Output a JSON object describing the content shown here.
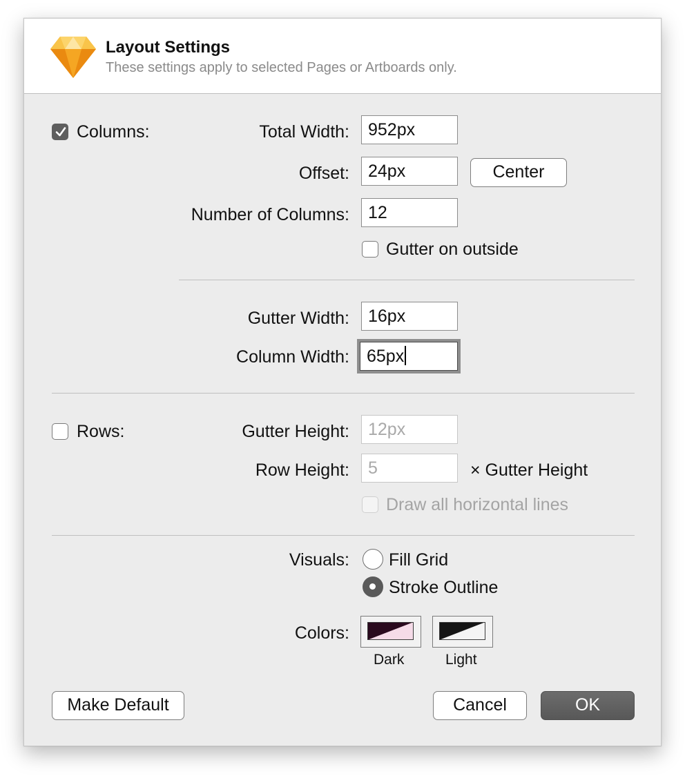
{
  "header": {
    "title": "Layout Settings",
    "subtitle": "These settings apply to selected Pages or Artboards only.",
    "logo_icon": "sketch-diamond-icon"
  },
  "columns": {
    "checkbox_label": "Columns:",
    "checked": true,
    "total_width_label": "Total Width:",
    "total_width_value": "952px",
    "offset_label": "Offset:",
    "offset_value": "24px",
    "center_label": "Center",
    "number_label": "Number of Columns:",
    "number_value": "12",
    "gutter_outside_label": "Gutter on outside",
    "gutter_outside_checked": false,
    "gutter_width_label": "Gutter Width:",
    "gutter_width_value": "16px",
    "column_width_label": "Column Width:",
    "column_width_value": "65px"
  },
  "rows": {
    "checkbox_label": "Rows:",
    "checked": false,
    "gutter_height_label": "Gutter Height:",
    "gutter_height_value": "12px",
    "row_height_label": "Row Height:",
    "row_height_value": "5",
    "row_height_suffix": "× Gutter Height",
    "draw_lines_label": "Draw all horizontal lines"
  },
  "visuals": {
    "label": "Visuals:",
    "options": [
      "Fill Grid",
      "Stroke Outline"
    ],
    "selected": "Stroke Outline"
  },
  "colors": {
    "label": "Colors:",
    "dark_label": "Dark",
    "light_label": "Light",
    "dark_colors": [
      "#2a0a1e",
      "#f5dbe8"
    ],
    "light_colors": [
      "#151515",
      "#f4f4f4"
    ]
  },
  "buttons": {
    "make_default": "Make Default",
    "cancel": "Cancel",
    "ok": "OK"
  }
}
